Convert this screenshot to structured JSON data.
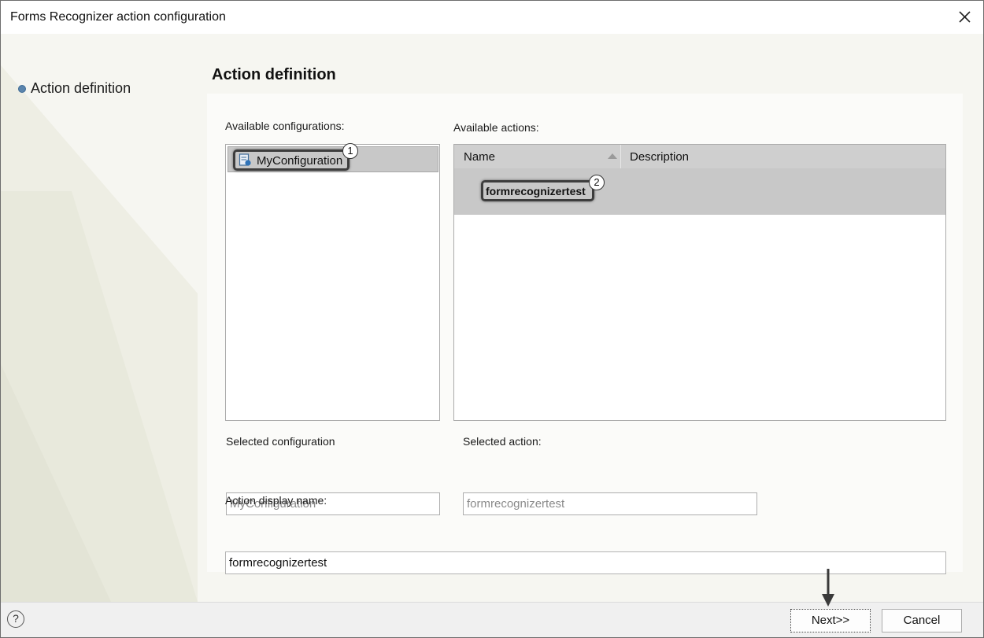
{
  "window": {
    "title": "Forms Recognizer action configuration"
  },
  "nav": {
    "steps": [
      {
        "label": "Action definition"
      }
    ]
  },
  "main": {
    "title": "Action definition",
    "available_configurations": {
      "label": "Available configurations:",
      "items": [
        {
          "label": "MyConfiguration",
          "icon": "configuration-icon",
          "callout": "1"
        }
      ]
    },
    "available_actions": {
      "label": "Available actions:",
      "columns": [
        "Name",
        "Description"
      ],
      "sort_indicator": "sort-ascending-icon",
      "rows": [
        {
          "name": "formrecognizertest",
          "description": "",
          "callout": "2"
        }
      ]
    },
    "selected_configuration": {
      "label": "Selected configuration",
      "value": "MyConfiguration"
    },
    "selected_action": {
      "label": "Selected action:",
      "value": "formrecognizertest"
    },
    "action_display_name": {
      "label": "Action display name:",
      "value": "formrecognizertest"
    }
  },
  "footer": {
    "help_label": "?",
    "next_label": "Next>>",
    "cancel_label": "Cancel"
  },
  "colors": {
    "selection_bg": "#c8c8c8",
    "header_bg": "#cfcfcf",
    "nav_dot": "#5b85ad",
    "content_bg": "#f6f6f1"
  }
}
